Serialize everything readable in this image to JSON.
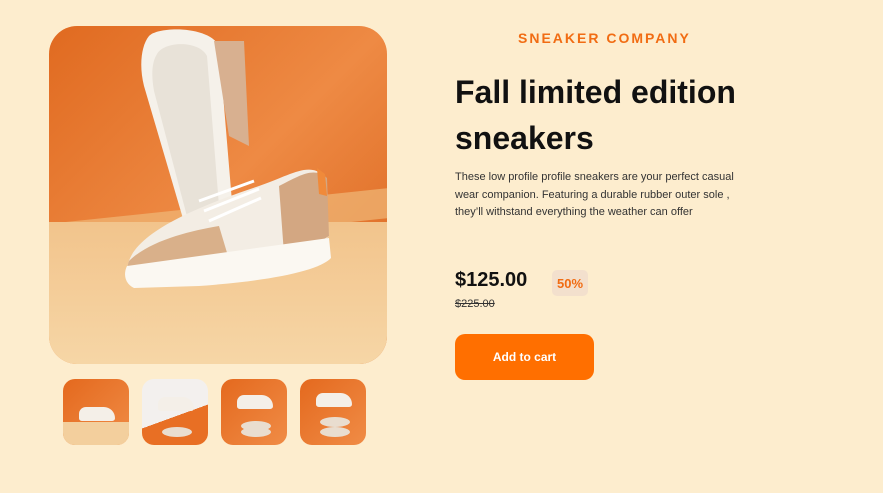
{
  "product": {
    "company": "SNEAKER COMPANY",
    "title": "Fall limited edition sneakers",
    "description": "These low profile profile sneakers are your perfect casual wear companion. Featuring a durable rubber outer sole , they’ll withstand everything the weather can offer",
    "price": "$125.00",
    "discount": "50%",
    "original_price": "$225.00",
    "add_to_cart_label": "Add to cart"
  },
  "colors": {
    "accent": "#ff6f00",
    "brand_text": "#f16c13",
    "background": "#fdedce"
  }
}
